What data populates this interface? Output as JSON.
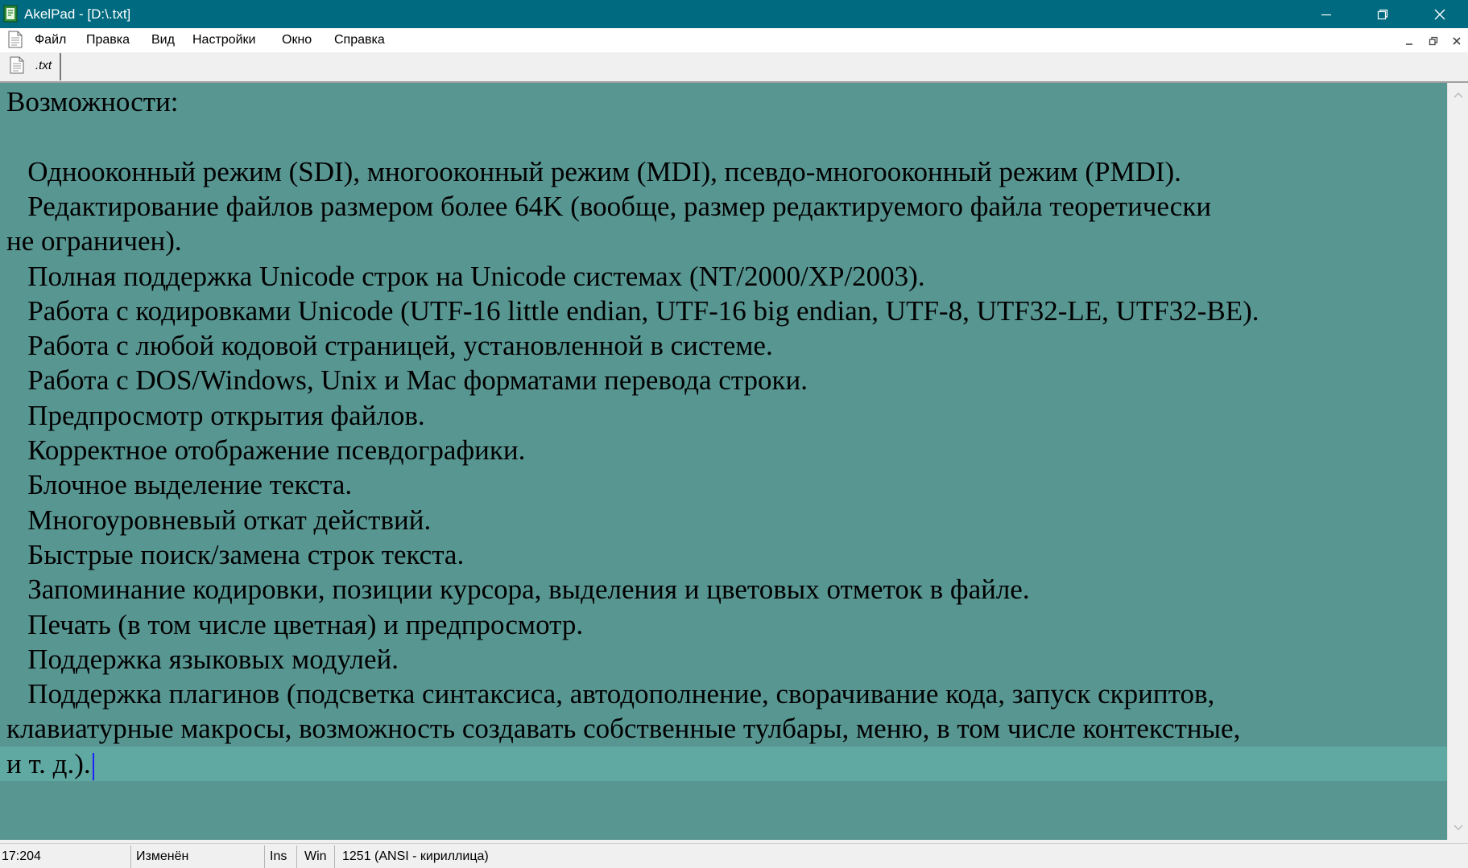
{
  "window": {
    "title": "AkelPad - [D:\\.txt]",
    "app_icon": "akelpad-icon",
    "controls": [
      "minimize-icon",
      "restore-icon",
      "close-icon"
    ]
  },
  "menubar": {
    "items": [
      {
        "label": "Файл"
      },
      {
        "label": "Правка"
      },
      {
        "label": "Вид"
      },
      {
        "label": "Настройки"
      },
      {
        "label": "Окно"
      },
      {
        "label": "Справка"
      }
    ],
    "mdi_controls": [
      "mdi-minimize-icon",
      "mdi-restore-icon",
      "mdi-close-icon"
    ]
  },
  "tabs": [
    {
      "label": ".txt",
      "icon": "document-icon",
      "active": true
    }
  ],
  "editor": {
    "background": "#589692",
    "current_line_background": "#5fa9a2",
    "lines": [
      "Возможности:",
      "",
      "   Однооконный режим (SDI), многооконный режим (MDI), псевдо-многооконный режим (PMDI).",
      "   Редактирование файлов размером более 64K (вообще, размер редактируемого файла теоретически",
      "не ограничен).",
      "   Полная поддержка Unicode строк на Unicode системах (NT/2000/XP/2003).",
      "   Работа с кодировками Unicode (UTF-16 little endian, UTF-16 big endian, UTF-8, UTF32-LE, UTF32-BE).",
      "   Работа с любой кодовой страницей, установленной в системе.",
      "   Работа с DOS/Windows, Unix и Mac форматами перевода строки.",
      "   Предпросмотр открытия файлов.",
      "   Корректное отображение псевдографики.",
      "   Блочное выделение текста.",
      "   Многоуровневый откат действий.",
      "   Быстрые поиск/замена строк текста.",
      "   Запоминание кодировки, позиции курсора, выделения и цветовых отметок в файле.",
      "   Печать (в том числе цветная) и предпросмотр.",
      "   Поддержка языковых модулей.",
      "   Поддержка плагинов (подсветка синтаксиса, автодополнение, сворачивание кода, запуск скриптов,",
      "клавиатурные макросы, возможность создавать собственные тулбары, меню, в том числе контекстные,",
      "и т. д.)."
    ]
  },
  "statusbar": {
    "position": "17:204",
    "modified": "Изменён",
    "insert_mode": "Ins",
    "newline": "Win",
    "codepage": "1251  (ANSI - кириллица)"
  }
}
